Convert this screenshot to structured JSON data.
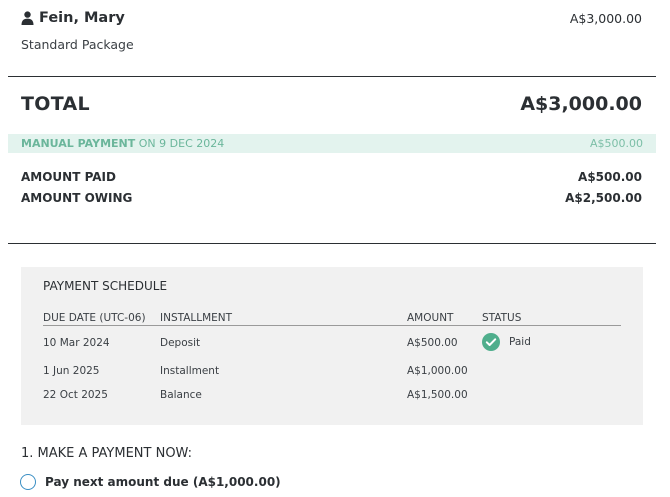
{
  "customer": {
    "name": "Fein, Mary",
    "amount": "A$3,000.00",
    "package": "Standard Package",
    "icon": "person-icon"
  },
  "total": {
    "label": "TOTAL",
    "amount": "A$3,000.00"
  },
  "payment_record": {
    "method": "MANUAL PAYMENT",
    "date_text": "ON 9 DEC 2024",
    "amount": "A$500.00"
  },
  "summary": {
    "paid_label": "AMOUNT PAID",
    "paid_value": "A$500.00",
    "owing_label": "AMOUNT OWING",
    "owing_value": "A$2,500.00"
  },
  "schedule": {
    "title": "PAYMENT SCHEDULE",
    "columns": [
      "DUE DATE (UTC-06)",
      "INSTALLMENT",
      "AMOUNT",
      "STATUS"
    ],
    "rows": [
      {
        "due_date": "10 Mar 2024",
        "installment": "Deposit",
        "amount": "A$500.00",
        "status": "Paid",
        "status_icon": "check-circle-icon"
      },
      {
        "due_date": "1 Jun 2025",
        "installment": "Installment",
        "amount": "A$1,000.00",
        "status": ""
      },
      {
        "due_date": "22 Oct 2025",
        "installment": "Balance",
        "amount": "A$1,500.00",
        "status": ""
      }
    ]
  },
  "make_payment": {
    "heading": "1. MAKE A PAYMENT NOW:",
    "option_label": "Pay next amount due (A$1,000.00)"
  },
  "colors": {
    "accent_green": "#6bb69b",
    "check_green": "#4fae8c",
    "radio_blue": "#3b8fc4"
  }
}
